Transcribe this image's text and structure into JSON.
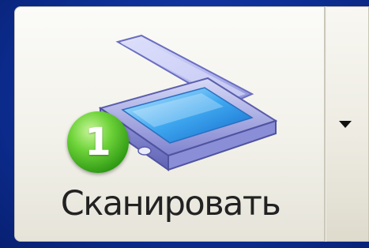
{
  "scan_button": {
    "label": "Сканировать",
    "badge_number": "1",
    "icon": "scanner-icon",
    "dropdown_icon": "chevron-down-icon"
  },
  "colors": {
    "background": "#0d2f96",
    "button_face": "#f2f1ea",
    "badge_green": "#3aa81c",
    "label_text": "#222222"
  }
}
